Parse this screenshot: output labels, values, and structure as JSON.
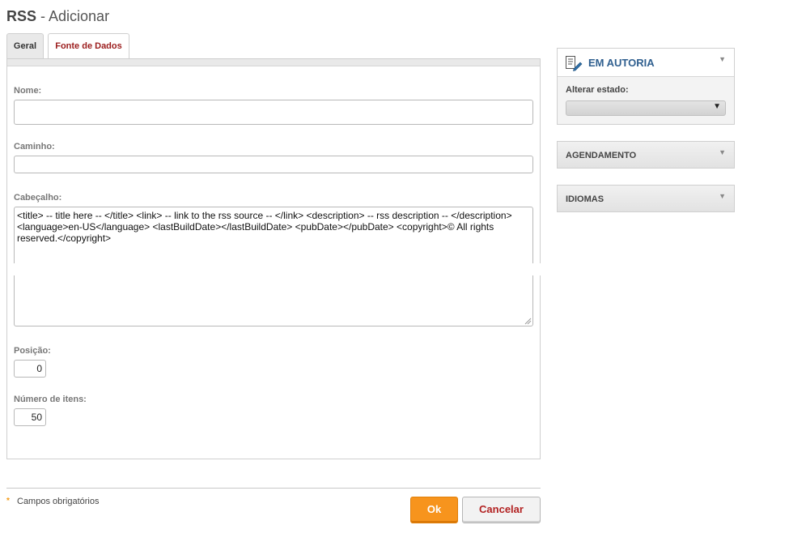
{
  "page": {
    "title_strong": "RSS",
    "title_rest": " - Adicionar"
  },
  "tabs": [
    {
      "label": "Geral",
      "active": true
    },
    {
      "label": "Fonte de Dados",
      "active": false
    }
  ],
  "form": {
    "name_label": "Nome:",
    "name_value": "",
    "path_label": "Caminho:",
    "path_value": "",
    "header_label": "Cabeçalho:",
    "header_value": "<title> -- title here -- </title>  <link> -- link to the rss source -- </link>  <description> -- rss description -- </description>  <language>en-US</language>  <lastBuildDate></lastBuildDate>  <pubDate></pubDate>  <copyright>© All rights reserved.</copyright>",
    "position_label": "Posição:",
    "position_value": "0",
    "items_label": "Número de itens:",
    "items_value": "50"
  },
  "footer": {
    "required_marker": "*",
    "required_text": "Campos obrigatórios",
    "ok_label": "Ok",
    "cancel_label": "Cancelar"
  },
  "sidebar": {
    "status": {
      "title": "EM AUTORIA",
      "icon": "edit-document-icon",
      "change_state_label": "Alterar estado:",
      "state_value": ""
    },
    "scheduling": {
      "title": "AGENDAMENTO"
    },
    "languages": {
      "title": "IDIOMAS"
    }
  },
  "colors": {
    "accent": "#f7941d",
    "link_red": "#9b1c1c",
    "status_blue": "#2f5f8f"
  }
}
